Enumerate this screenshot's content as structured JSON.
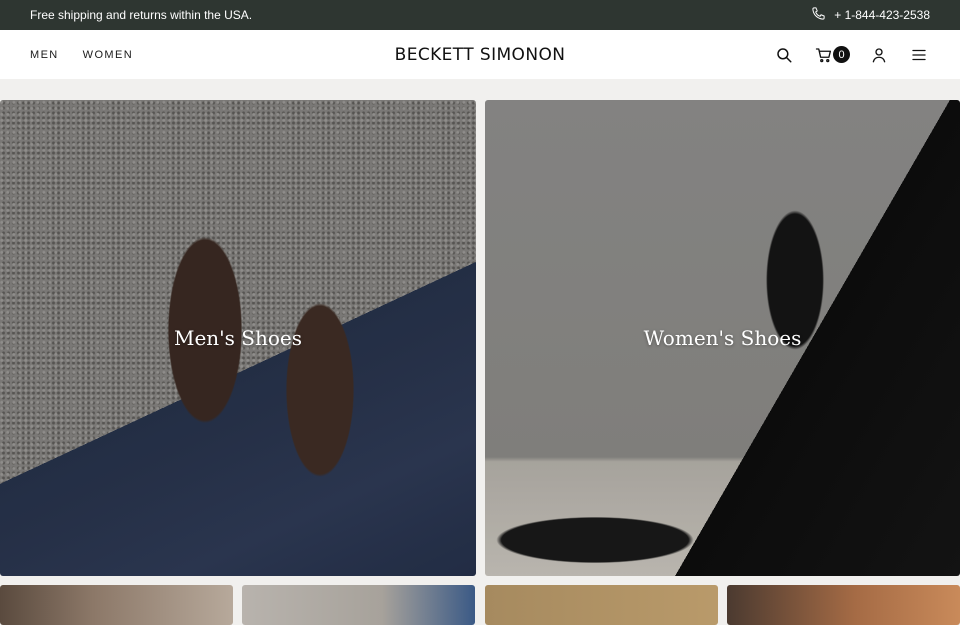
{
  "announcement": {
    "text": "Free shipping and returns within the USA.",
    "phone": "+ 1-844-423-2538"
  },
  "header": {
    "nav": [
      {
        "label": "MEN"
      },
      {
        "label": "WOMEN"
      }
    ],
    "logo": "BECKETT SIMONON",
    "cart_count": "0"
  },
  "tiles": [
    {
      "label": "Men's Shoes"
    },
    {
      "label": "Women's Shoes"
    }
  ],
  "colors": {
    "announcement_bg": "#2e3631",
    "page_bg": "#f1f0ee",
    "badge_bg": "#111111"
  }
}
